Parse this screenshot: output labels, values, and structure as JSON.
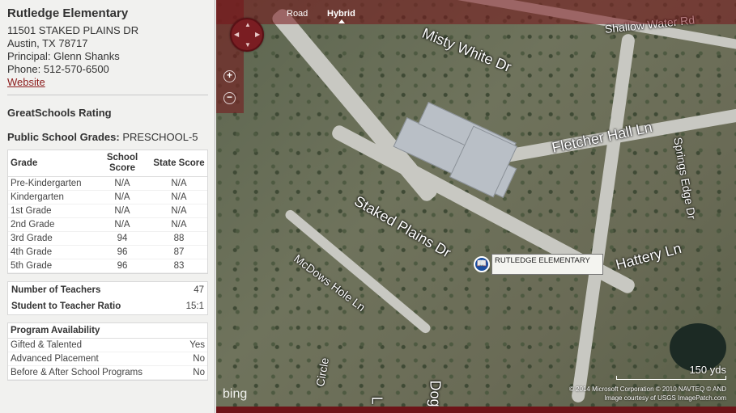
{
  "school": {
    "name": "Rutledge Elementary",
    "address1": "11501 STAKED PLAINS DR",
    "address2": "Austin, TX 78717",
    "principal": "Principal: Glenn Shanks",
    "phone": "Phone: 512-570-6500",
    "website_label": "Website"
  },
  "rating": {
    "title": "GreatSchools Rating"
  },
  "grades": {
    "heading": "Public School Grades:",
    "range": "PRESCHOOL-5",
    "columns": {
      "grade": "Grade",
      "school": "School Score",
      "state": "State Score"
    },
    "rows": [
      {
        "grade": "Pre-Kindergarten",
        "school": "N/A",
        "state": "N/A"
      },
      {
        "grade": "Kindergarten",
        "school": "N/A",
        "state": "N/A"
      },
      {
        "grade": "1st Grade",
        "school": "N/A",
        "state": "N/A"
      },
      {
        "grade": "2nd Grade",
        "school": "N/A",
        "state": "N/A"
      },
      {
        "grade": "3rd Grade",
        "school": "94",
        "state": "88"
      },
      {
        "grade": "4th Grade",
        "school": "96",
        "state": "87"
      },
      {
        "grade": "5th Grade",
        "school": "96",
        "state": "83"
      }
    ]
  },
  "stats": {
    "teachers_label": "Number of Teachers",
    "teachers_value": "47",
    "ratio_label": "Student to Teacher Ratio",
    "ratio_value": "15:1"
  },
  "programs": {
    "title": "Program Availability",
    "items": [
      {
        "label": "Gifted & Talented",
        "value": "Yes"
      },
      {
        "label": "Advanced Placement",
        "value": "No"
      },
      {
        "label": "Before & After School Programs",
        "value": "No"
      }
    ]
  },
  "map": {
    "tabs": {
      "road": "Road",
      "hybrid": "Hybrid"
    },
    "active_tab": "Hybrid",
    "streets": {
      "misty_white": "Misty White Dr",
      "shallow_water": "Shallow Water Rd",
      "fletcher_hall": "Fletcher Hall Ln",
      "springs_edge": "Springs Edge Dr",
      "staked_plains": "Staked Plains Dr",
      "mcdows_hole": "McDows Hole Ln",
      "hattery": "Hattery Ln",
      "dog": "Dog",
      "circle": "Circle",
      "l": "L"
    },
    "pin_label": "RUTLEDGE ELEMENTARY",
    "scale": "150 yds",
    "copyright_line1": "© 2014 Microsoft Corporation   © 2010 NAVTEQ   © AND",
    "copyright_line2": "Image courtesy of USGS   ImagePatch.com",
    "bing": "bing",
    "colors": {
      "accent": "#7a1d22",
      "link": "#8b1a1a",
      "pin": "#1b4fa0"
    }
  }
}
